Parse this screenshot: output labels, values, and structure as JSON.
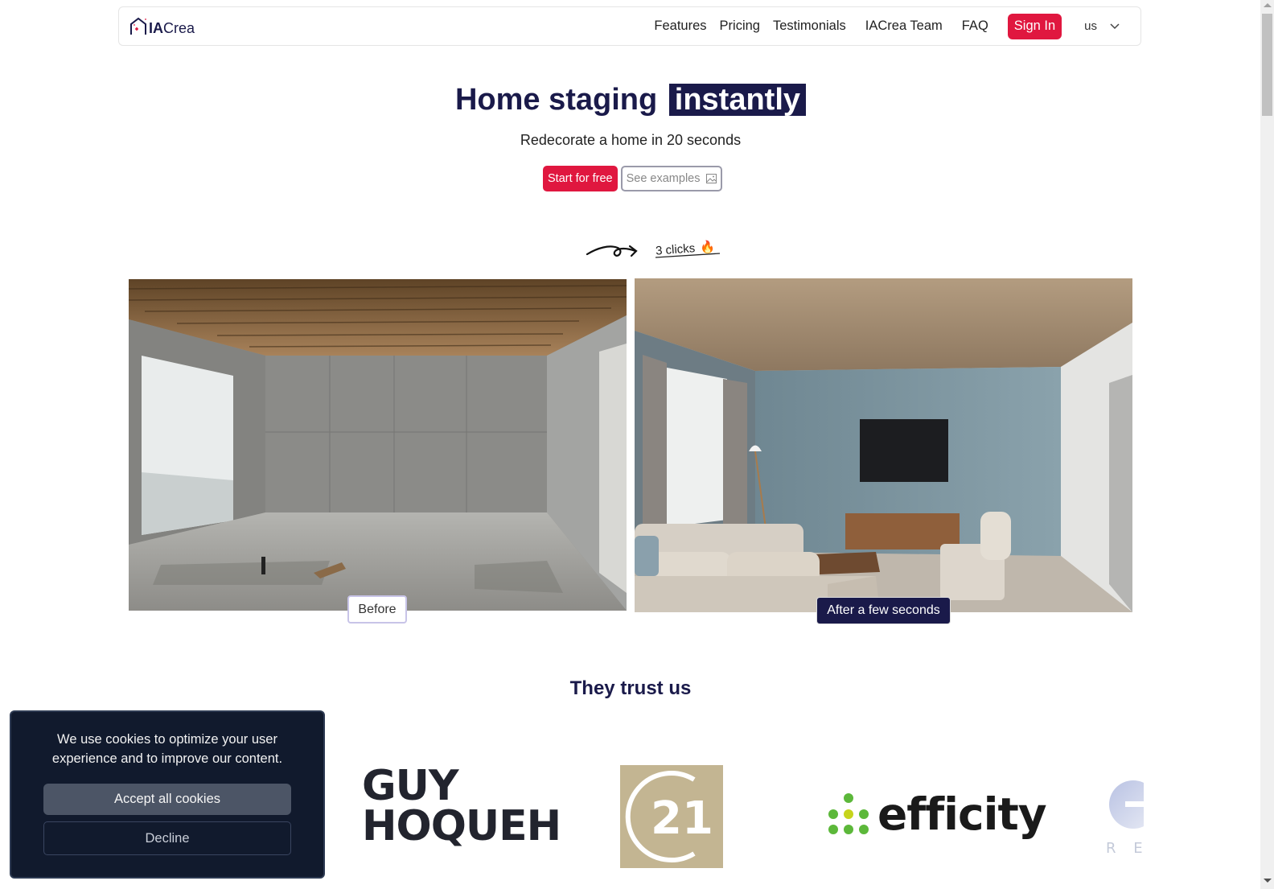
{
  "navbar": {
    "brand_bold": "IA",
    "brand_rest": "Crea",
    "links": [
      {
        "label": "Features"
      },
      {
        "label": "Pricing"
      },
      {
        "label": "Testimonials"
      },
      {
        "label": "IACrea Team"
      },
      {
        "label": "FAQ"
      }
    ],
    "signin_label": "Sign In",
    "language": "us"
  },
  "hero": {
    "title_main": "Home staging",
    "title_highlight": "instantly",
    "subtitle": "Redecorate a home in 20 seconds",
    "start_label": "Start for free",
    "examples_label": "See examples",
    "clicks_label": "3 clicks",
    "clicks_emoji": "🔥"
  },
  "comparison": {
    "before_label": "Before",
    "after_label": "After a few seconds"
  },
  "trust": {
    "title": "They trust us",
    "logos": [
      {
        "name": "GUY HOQUET",
        "line1": "GUY",
        "line2": "HOQUEH"
      },
      {
        "name": "Century 21",
        "text": "21"
      },
      {
        "name": "efficity",
        "text": "efficity"
      },
      {
        "name": "partial logo",
        "text": "R E"
      }
    ]
  },
  "cookie_banner": {
    "message": "We use cookies to optimize your user experience and to improve our content.",
    "accept_label": "Accept all cookies",
    "decline_label": "Decline"
  },
  "colors": {
    "accent": "#e0173f",
    "navy": "#1a1a4a",
    "cookie_bg": "#111a2d"
  }
}
